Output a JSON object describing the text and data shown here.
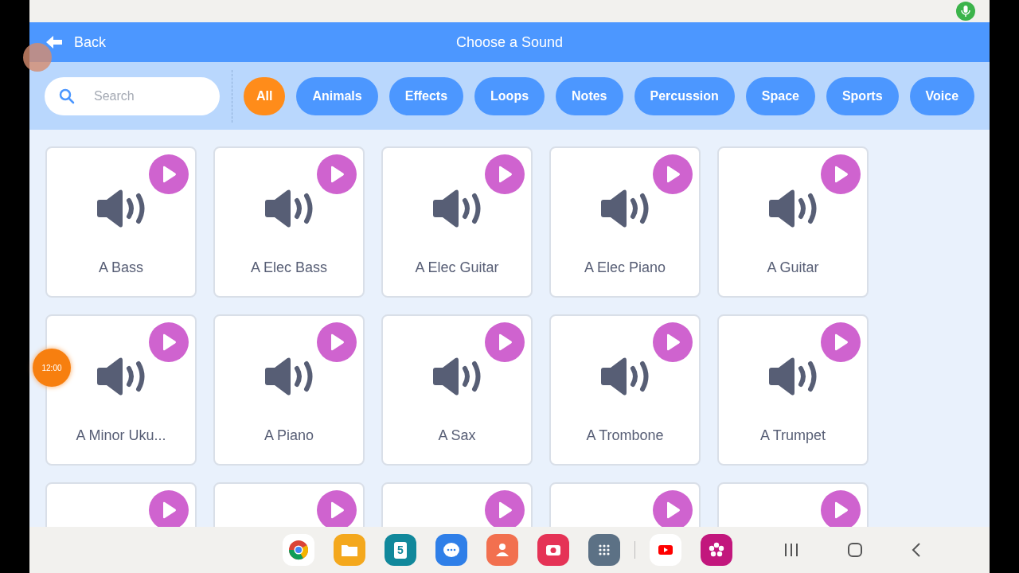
{
  "header": {
    "back": "Back",
    "title": "Choose a Sound"
  },
  "search": {
    "placeholder": "Search"
  },
  "categories": [
    {
      "label": "All",
      "selected": true
    },
    {
      "label": "Animals",
      "selected": false
    },
    {
      "label": "Effects",
      "selected": false
    },
    {
      "label": "Loops",
      "selected": false
    },
    {
      "label": "Notes",
      "selected": false
    },
    {
      "label": "Percussion",
      "selected": false
    },
    {
      "label": "Space",
      "selected": false
    },
    {
      "label": "Sports",
      "selected": false
    },
    {
      "label": "Voice",
      "selected": false
    }
  ],
  "sounds": [
    {
      "kind": "sound",
      "name": "A Bass"
    },
    {
      "kind": "sound",
      "name": "A Elec Bass"
    },
    {
      "kind": "sound",
      "name": "A Elec Guitar"
    },
    {
      "kind": "sound",
      "name": "A Elec Piano"
    },
    {
      "kind": "sound",
      "name": "A Guitar"
    },
    {
      "kind": "sound",
      "name": "A Minor Uku..."
    },
    {
      "kind": "sound",
      "name": "A Piano"
    },
    {
      "kind": "sound",
      "name": "A Sax"
    },
    {
      "kind": "sound",
      "name": "A Trombone"
    },
    {
      "kind": "sound",
      "name": "A Trumpet"
    },
    {
      "kind": "clipped"
    },
    {
      "kind": "clipped"
    },
    {
      "kind": "clipped"
    },
    {
      "kind": "clipped"
    },
    {
      "kind": "clipped"
    }
  ],
  "clock_overlay": "12:00",
  "dock": {
    "calendar_day": "5"
  }
}
